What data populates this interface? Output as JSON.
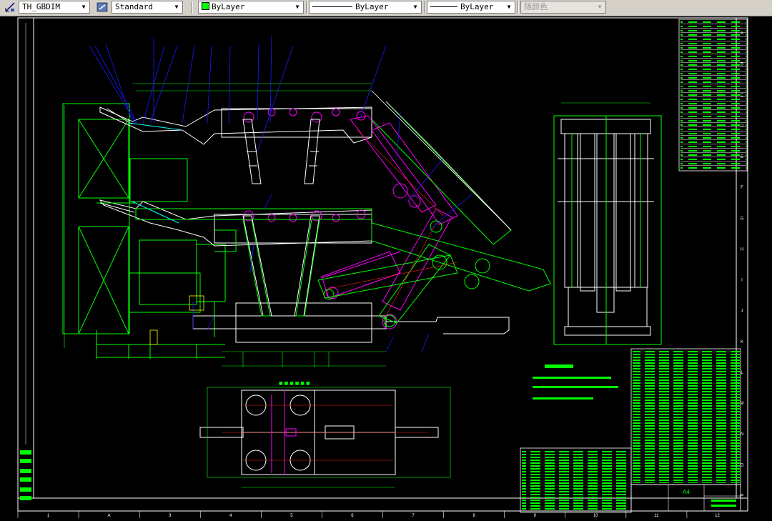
{
  "toolbar": {
    "dimstyle": "TH_GBDIM",
    "textstyle": "Standard",
    "layer_color": "ByLayer",
    "linetype": "ByLayer",
    "lineweight": "ByLayer",
    "plotstyle": "随颜色",
    "dropdown_glyph": "▼"
  },
  "drawing": {
    "title_block_label": "A4",
    "bottom_grid": [
      "1",
      "A",
      "3",
      "4",
      "5",
      "6",
      "7",
      "8",
      "9",
      "10",
      "11",
      "12"
    ],
    "right_grid": [
      "A",
      "B",
      "C",
      "D",
      "E",
      "F",
      "G",
      "H",
      "I",
      "J",
      "K",
      "L",
      "M",
      "N",
      "O",
      "P"
    ]
  },
  "colors": {
    "background": "#000000",
    "green": "#00ff00",
    "magenta": "#ff00ff",
    "white": "#ffffff",
    "blue": "#1a1aff",
    "cyan": "#00ffff",
    "red": "#ff2020",
    "yellow": "#ffff00"
  }
}
